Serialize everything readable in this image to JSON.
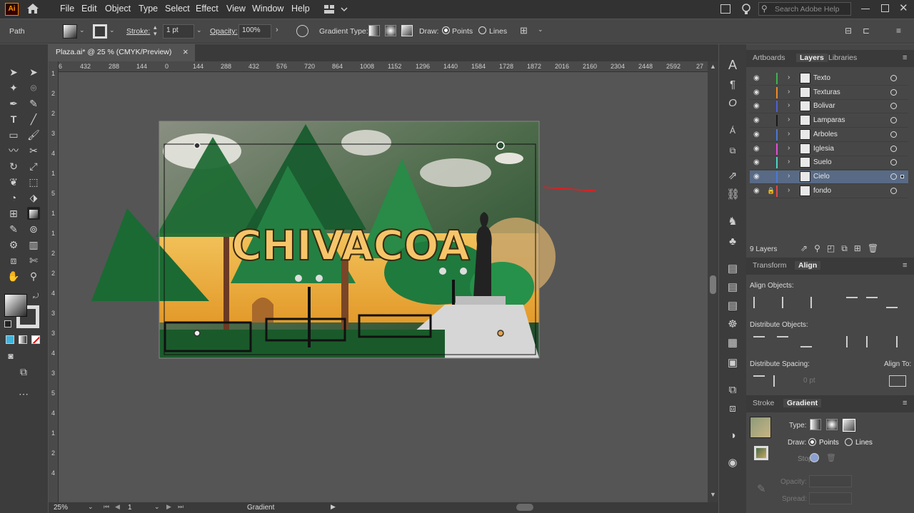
{
  "app": {
    "logo": "Ai",
    "home_icon": "home-icon"
  },
  "menu": [
    "File",
    "Edit",
    "Object",
    "Type",
    "Select",
    "Effect",
    "View",
    "Window",
    "Help"
  ],
  "search": {
    "placeholder": "Search Adobe Help"
  },
  "control": {
    "selection": "Path",
    "stroke_label": "Stroke:",
    "stroke_value": "1 pt",
    "opacity_label": "Opacity:",
    "opacity_value": "100%",
    "gradient_type_label": "Gradient Type:",
    "draw_label": "Draw:",
    "points_label": "Points",
    "lines_label": "Lines"
  },
  "document_tab": {
    "title": "Plaza.ai* @ 25 % (CMYK/Preview)",
    "close": "×"
  },
  "ruler_top": [
    "6",
    "432",
    "288",
    "144",
    "0",
    "144",
    "288",
    "432",
    "576",
    "720",
    "864",
    "1008",
    "1152",
    "1296",
    "1440",
    "1584",
    "1728",
    "1872",
    "2016",
    "2160",
    "2304",
    "2448",
    "2592",
    "27"
  ],
  "ruler_left": [
    "1",
    "2",
    "2",
    "3",
    "4",
    "1",
    "5",
    "1",
    "1",
    "2",
    "2",
    "4",
    "3",
    "3",
    "4",
    "3",
    "5",
    "4",
    "1",
    "2",
    "4"
  ],
  "artwork": {
    "title_text": "CHIVACOA"
  },
  "status": {
    "zoom": "25%",
    "page": "1",
    "tool": "Gradient"
  },
  "panels": {
    "layers_tabs": [
      "Artboards",
      "Layers",
      "Libraries"
    ],
    "layers": [
      {
        "name": "Texto",
        "color": "#3bb54a",
        "selected": false,
        "locked": false
      },
      {
        "name": "Texturas",
        "color": "#f08a24",
        "selected": false,
        "locked": false
      },
      {
        "name": "Bolivar",
        "color": "#4f5fd6",
        "selected": false,
        "locked": false
      },
      {
        "name": "Lamparas",
        "color": "#1a1a1a",
        "selected": false,
        "locked": false
      },
      {
        "name": "Arboles",
        "color": "#4a78d6",
        "selected": false,
        "locked": false
      },
      {
        "name": "Iglesia",
        "color": "#e14fd6",
        "selected": false,
        "locked": false
      },
      {
        "name": "Suelo",
        "color": "#47d6c4",
        "selected": false,
        "locked": false
      },
      {
        "name": "Cielo",
        "color": "#4a7ad6",
        "selected": true,
        "locked": false
      },
      {
        "name": "fondo",
        "color": "#e04848",
        "selected": false,
        "locked": true
      }
    ],
    "layers_count": "9 Layers",
    "align_tabs": [
      "Transform",
      "Align"
    ],
    "align_objects_label": "Align Objects:",
    "distribute_objects_label": "Distribute Objects:",
    "distribute_spacing_label": "Distribute Spacing:",
    "align_to_label": "Align To:",
    "spacing_value": "0 pt",
    "gradient_tabs": [
      "Stroke",
      "Gradient"
    ],
    "gradient_type_label": "Type:",
    "gradient_draw_label": "Draw:",
    "gradient_points": "Points",
    "gradient_lines": "Lines",
    "stop_label": "Stop:",
    "opacity_label": "Opacity:",
    "spread_label": "Spread:"
  },
  "colors": {
    "accent": "#586a85",
    "annotation": "#e01f1f"
  }
}
